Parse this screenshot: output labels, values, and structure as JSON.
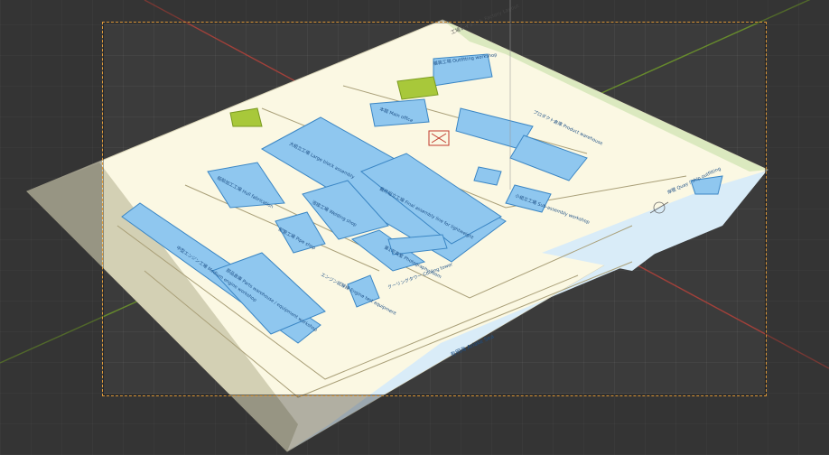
{
  "viewport": {
    "colors": {
      "background": "#3b3b3b",
      "grid": "#4a4a4a",
      "axis_x": "#c0392b",
      "axis_y": "#7aa22a",
      "camera_border": "#e09a3a"
    }
  },
  "map": {
    "colors": {
      "paper": "#fbf8e3",
      "building": "#8fc7ef",
      "building_stroke": "#3b86c4",
      "green": "#a8c83a",
      "sea": "#d8ecf9",
      "road": "#b8b08a"
    },
    "title": "工場レイアウト Factory Layout",
    "labels": {
      "outfitting": "艤装工場 Outfitting workshop",
      "block_assembly": "大組立工場 Large block assembly",
      "hull_fab": "船殻加工工場 Hull fabrication",
      "welding": "溶接工場 Welding shop",
      "final_assembly": "最終組立工場 Final assembly line for lightweight",
      "piping": "配管工場 Pipe shop",
      "sub_assembly": "小組立工場 Sub-assembly workshop",
      "engine_workshop": "中型エンジン工場 Medium engine workshop",
      "parts_warehouse": "部品倉庫 Parts warehouse / equipment workshop",
      "photo_room": "第1写真室 Photography room",
      "engine_test": "エンジン試験棟 Engine test equipment",
      "cooling_tower": "クーリングタワー Cooling tower",
      "product_warehouse": "プロダクト倉庫 Product warehouse",
      "main_office": "本館 Main office",
      "sea": "有明海 Ariake Sea",
      "pier": "岸壁 Quay / ship outfitting"
    }
  }
}
